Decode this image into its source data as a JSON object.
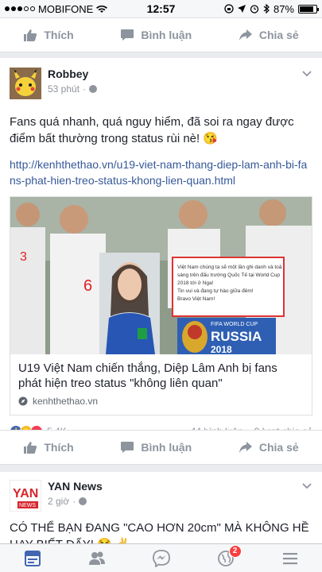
{
  "status_bar": {
    "carrier": "MOBIFONE",
    "time": "12:57",
    "battery": "87%",
    "battery_level": 0.87
  },
  "top_actions": {
    "like": "Thích",
    "comment": "Bình luận",
    "share": "Chia sẻ"
  },
  "post1": {
    "author": "Robbey",
    "time": "53 phút",
    "text": "Fans quá nhanh, quá nguy hiểm, đã soi ra ngay được điểm bất thường trong status rùi nè! 😘",
    "link": "http://kenhthethao.vn/u19-viet-nam-thang-diep-lam-anh-bi-fans-phat-hien-treo-status-khong-lien-quan.html",
    "card": {
      "title": "U19 Việt Nam chiến thắng, Diệp Lâm Anh bị fans phát hiện treo status \"không liên quan\"",
      "source": "kenhthethao.vn",
      "image_text": {
        "status_lines": [
          "Việt Nam chúng ta sẽ một lần ghi danh và toả",
          "sáng trên đấu trường Quốc Tế tại World Cup",
          "2018 tới ở Nga!",
          "Tin vui và đang tự hào giữa đêm!",
          "Bravo Việt Nam!"
        ],
        "fifa": "FIFA WORLD CUP",
        "russia": "RUSSIA",
        "year": "2018",
        "jerseys": [
          "3",
          "6"
        ]
      }
    },
    "reactions_count": "5,4K",
    "comments": "44 bình luận",
    "shares": "9 lượt chia sẻ",
    "actions": {
      "like": "Thích",
      "comment": "Bình luận",
      "share": "Chia sẻ"
    }
  },
  "post2": {
    "author": "YAN News",
    "time": "2 giờ",
    "avatar_text": "YAN",
    "avatar_sub": "NEWS",
    "text": "CÓ THỂ BẠN ĐANG \"CAO HƠN 20cm\" MÀ KHÔNG HỀ HAY BIẾT ĐẤY! 😂 ✌"
  },
  "tab_bar": {
    "notifications_badge": "2"
  },
  "colors": {
    "fb_blue": "#4267b2",
    "link": "#365899",
    "badge": "#fa3e3e"
  }
}
